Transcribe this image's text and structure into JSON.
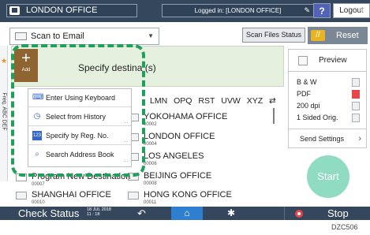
{
  "topbar": {
    "app_title": "LONDON OFFICE",
    "login_status": "Logged in: [LONDON OFFICE]",
    "help_label": "?",
    "logout_label": "Logout",
    "moon_glyph": "☾",
    "pen_glyph": "✎"
  },
  "toolbar": {
    "scan_mode": "Scan to Email",
    "scan_files_status_label": "Scan Files Status",
    "reset_label": "Reset",
    "reset_icon": "//"
  },
  "destination": {
    "add_label": "Add",
    "header_text": "Specify destina       (s)",
    "tabs": [
      "LMN",
      "OPQ",
      "RST",
      "UVW",
      "XYZ",
      "⇄"
    ],
    "side_tab_text": "Freq. ABC DEF",
    "rows": [
      {
        "name": "YOKOHAMA OFFICE",
        "num": "00002"
      },
      {
        "name": "LONDON OFFICE",
        "num": "00004"
      },
      {
        "name": "LOS ANGELES",
        "num": "00006"
      },
      {
        "name": "BEIJING OFFICE",
        "num": "00008"
      },
      {
        "name": "HONG KONG OFFICE",
        "num": "00011"
      }
    ],
    "left_rows": [
      {
        "name": "Program New Destination",
        "num": "00007"
      },
      {
        "name": "SHANGHAI OFFICE",
        "num": "00010"
      }
    ]
  },
  "menu": {
    "items": [
      {
        "label": "Enter Using Keyboard",
        "icon": "keyboard-icon",
        "glyph": "⌨"
      },
      {
        "label": "Select from History",
        "icon": "history-icon",
        "glyph": "◷"
      },
      {
        "label": "Specify by Reg. No.",
        "icon": "reg-number-icon",
        "glyph": "123"
      },
      {
        "label": "Search Address Book",
        "icon": "search-icon",
        "glyph": "⌕"
      }
    ]
  },
  "right_panel": {
    "preview_label": "Preview",
    "settings": [
      "B & W",
      "PDF",
      "200 dpi",
      "1 Sided Orig."
    ],
    "send_settings_label": "Send Settings",
    "start_label": "Start"
  },
  "bottombar": {
    "check_status_label": "Check Status",
    "date": "18 JUL 2018",
    "time": "11 : 18",
    "stop_label": "Stop"
  },
  "caption": "DZC506",
  "colors": {
    "bar": "#35475c",
    "green_highlight": "#1fa05a",
    "add_tile": "#8e6431",
    "start": "#8fdcc2",
    "home": "#2f7fd1",
    "reset_icon": "#e8b423"
  }
}
